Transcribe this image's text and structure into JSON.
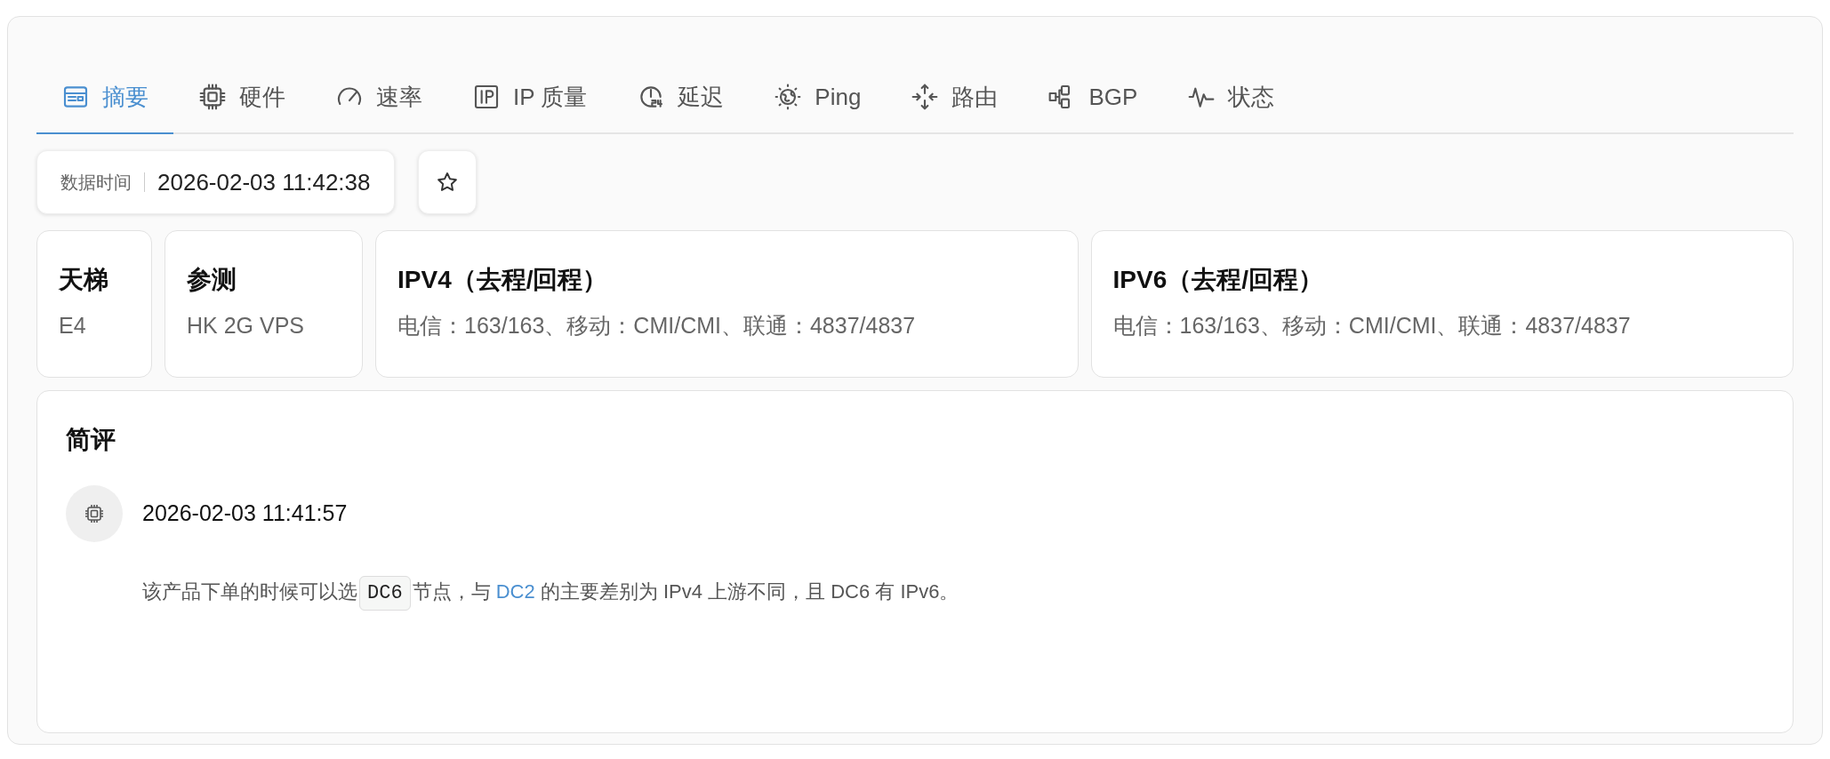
{
  "tabs": [
    {
      "label": "摘要",
      "selected": true
    },
    {
      "label": "硬件",
      "selected": false
    },
    {
      "label": "速率",
      "selected": false
    },
    {
      "label": "IP 质量",
      "selected": false
    },
    {
      "label": "延迟",
      "selected": false
    },
    {
      "label": "Ping",
      "selected": false
    },
    {
      "label": "路由",
      "selected": false
    },
    {
      "label": "BGP",
      "selected": false
    },
    {
      "label": "状态",
      "selected": false
    }
  ],
  "data_time": {
    "label": "数据时间",
    "value": "2026-02-03 11:42:38"
  },
  "info_cards": [
    {
      "title": "天梯",
      "value": "E4"
    },
    {
      "title": "参测",
      "value": "HK 2G VPS"
    },
    {
      "title": "IPV4（去程/回程）",
      "value": "电信：163/163、移动：CMI/CMI、联通：4837/4837"
    },
    {
      "title": "IPV6（去程/回程）",
      "value": "电信：163/163、移动：CMI/CMI、联通：4837/4837"
    }
  ],
  "review": {
    "title": "简评",
    "time": "2026-02-03 11:41:57",
    "segments": [
      {
        "kind": "text",
        "text": "该产品下单的时候可以选"
      },
      {
        "kind": "code",
        "text": "DC6"
      },
      {
        "kind": "text",
        "text": "节点，与 "
      },
      {
        "kind": "link",
        "text": "DC2"
      },
      {
        "kind": "text",
        "text": " 的主要差别为 IPv4 上游不同，且 DC6 有 IPv6。"
      }
    ]
  }
}
